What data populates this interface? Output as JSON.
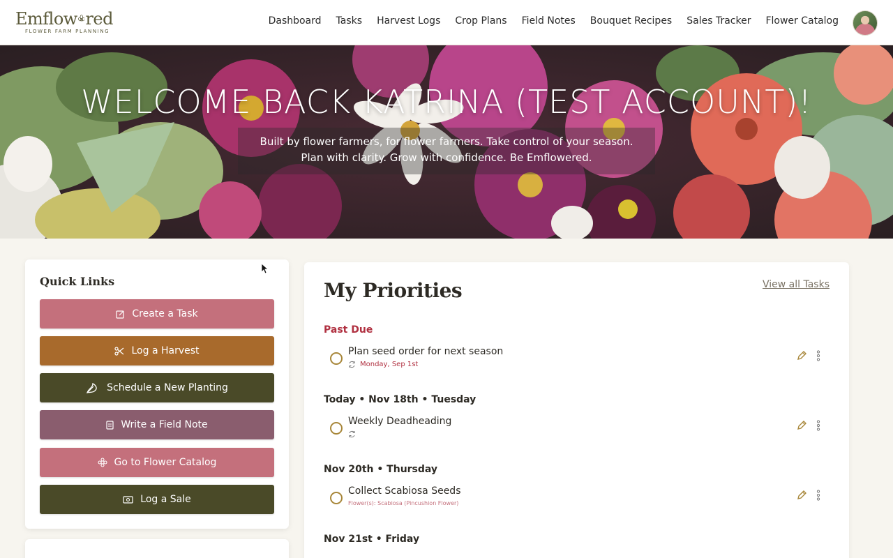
{
  "brand": {
    "name_part1": "Emflow",
    "name_part2": "red",
    "tagline": "FLOWER FARM PLANNING"
  },
  "nav": {
    "items": [
      "Dashboard",
      "Tasks",
      "Harvest Logs",
      "Crop Plans",
      "Field Notes",
      "Bouquet Recipes",
      "Sales Tracker",
      "Flower Catalog"
    ]
  },
  "hero": {
    "title": "WELCOME BACK KATRINA (TEST ACCOUNT)!",
    "subtitle": "Built by flower farmers, for flower farmers. Take control of your season. Plan with clarity. Grow with confidence. Be Emflowered."
  },
  "quick_links": {
    "title": "Quick Links",
    "buttons": [
      {
        "label": "Create a Task",
        "icon": "edit-square-icon",
        "color": "#c4707c"
      },
      {
        "label": "Log a Harvest",
        "icon": "scissors-icon",
        "color": "#a86a2c"
      },
      {
        "label": "Schedule a New Planting",
        "icon": "sprout-icon",
        "color": "#4a4a28"
      },
      {
        "label": "Write a Field Note",
        "icon": "note-icon",
        "color": "#8a5d6e"
      },
      {
        "label": "Go to Flower Catalog",
        "icon": "flower-icon",
        "color": "#c4707c"
      },
      {
        "label": "Log a Sale",
        "icon": "cash-icon",
        "color": "#4a4a28"
      }
    ]
  },
  "priorities": {
    "title": "My Priorities",
    "view_all": "View all Tasks",
    "groups": [
      {
        "label": "Past Due",
        "overdue": true,
        "tasks": [
          {
            "name": "Plan seed order for next season",
            "date": "Monday, Sep 1st",
            "recurring": true
          }
        ]
      },
      {
        "label": "Today • Nov 18th • Tuesday",
        "overdue": false,
        "tasks": [
          {
            "name": "Weekly Deadheading",
            "recurring": true
          }
        ]
      },
      {
        "label": "Nov 20th • Thursday",
        "overdue": false,
        "tasks": [
          {
            "name": "Collect Scabiosa Seeds",
            "flowers": "Flower(s):  Scabiosa (Pincushion Flower)"
          }
        ]
      },
      {
        "label": "Nov 21st • Friday",
        "overdue": false,
        "tasks": []
      }
    ]
  },
  "colors": {
    "accent_rose": "#c4707c",
    "accent_olive": "#4a4a28",
    "overdue_red": "#b03040",
    "check_gold": "#a8873a"
  }
}
